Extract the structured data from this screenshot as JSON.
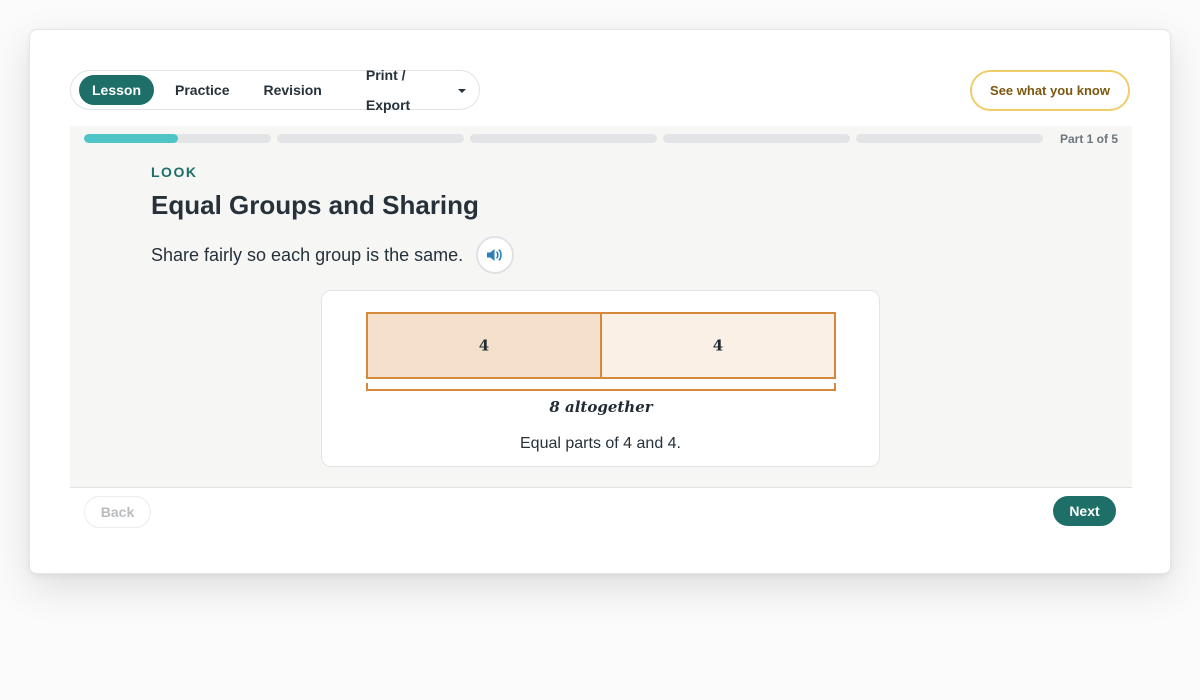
{
  "tabs": [
    {
      "label": "Lesson",
      "active": true
    },
    {
      "label": "Practice",
      "active": false
    },
    {
      "label": "Revision",
      "active": false
    },
    {
      "label": "Print / Export",
      "active": false
    }
  ],
  "see_what_you_know": "See what you know",
  "progress": {
    "total_parts": 5,
    "current_part": 1,
    "current_fill_fraction": 0.5,
    "label": "Part 1 of 5"
  },
  "lesson": {
    "eyebrow": "LOOK",
    "title": "Equal Groups and Sharing",
    "instruction": "Share fairly so each group is the same."
  },
  "bar_model": {
    "parts": [
      4,
      4
    ],
    "part_labels": [
      "4",
      "4"
    ],
    "part_colors": [
      "#f4e0cb",
      "#faf0e6"
    ],
    "border_color": "#d4893c",
    "total_label": "8 altogether",
    "caption": "Equal parts of 4 and 4."
  },
  "icons": {
    "audio": "speaker-icon",
    "dropdown": "chevron-down-icon"
  },
  "colors": {
    "primary": "#1d6f67",
    "progress": "#4fc4c6",
    "accent_border": "#f0cd6b"
  },
  "nav": {
    "back": "Back",
    "next": "Next"
  }
}
